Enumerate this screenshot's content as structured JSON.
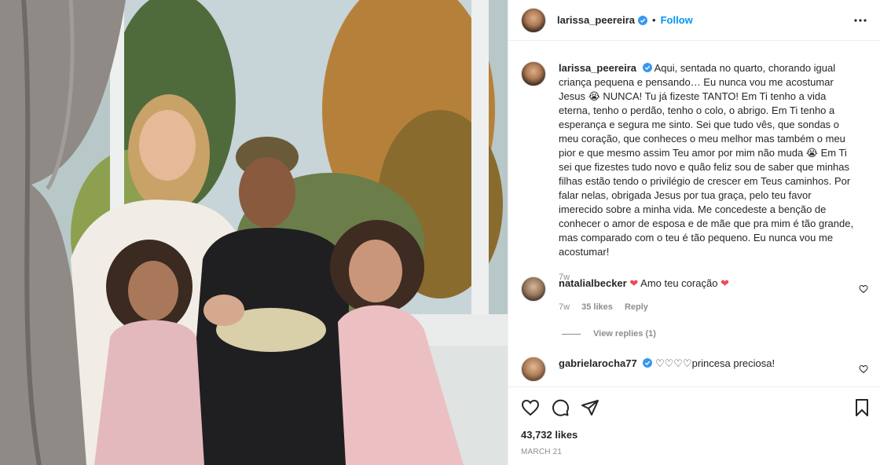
{
  "post": {
    "author": "larissa_peereira",
    "separator": "•",
    "follow_label": "Follow",
    "caption": "Aqui, sentada no quarto, chorando igual criança pequena e pensando… Eu nunca vou me acostumar Jesus 😭 NUNCA! Tu já fizeste TANTO! Em Ti tenho a vida eterna, tenho o perdão, tenho o colo, o abrigo. Em Ti tenho a esperança e segura me sinto. Sei que tudo vês, que sondas o meu coração, que conheces o meu melhor mas também o meu pior e que mesmo assim Teu amor por mim não muda 😭 Em Ti sei que fizestes tudo novo e quão feliz sou de saber que minhas filhas estão tendo o privilégio de crescer em Teus caminhos. Por falar nelas, obrigada Jesus por tua graça, pelo teu favor imerecido sobre a minha vida. Me concedeste a benção de conhecer o amor de esposa e de mãe que pra mim é tão grande, mas comparado com o teu é tão pequeno. Eu nunca vou me acostumar!",
    "caption_time": "7w",
    "likes": "43,732 likes",
    "date": "MARCH 21"
  },
  "comments": [
    {
      "user": "natalialbecker",
      "text_before": "",
      "text": "Amo teu coração",
      "time": "7w",
      "likes": "35 likes",
      "reply_label": "Reply",
      "view_replies": "View replies (1)"
    },
    {
      "user": "gabrielarocha77",
      "text": "♡♡♡♡princesa preciosa!"
    }
  ],
  "icons": {
    "verified": "verified-badge-icon",
    "more": "more-options-icon",
    "like": "heart-icon",
    "comment": "comment-icon",
    "share": "share-icon",
    "save": "bookmark-icon"
  },
  "colors": {
    "accent": "#0095f6",
    "heart": "#ed4956",
    "muted": "#8e8e8e",
    "text": "#262626"
  }
}
